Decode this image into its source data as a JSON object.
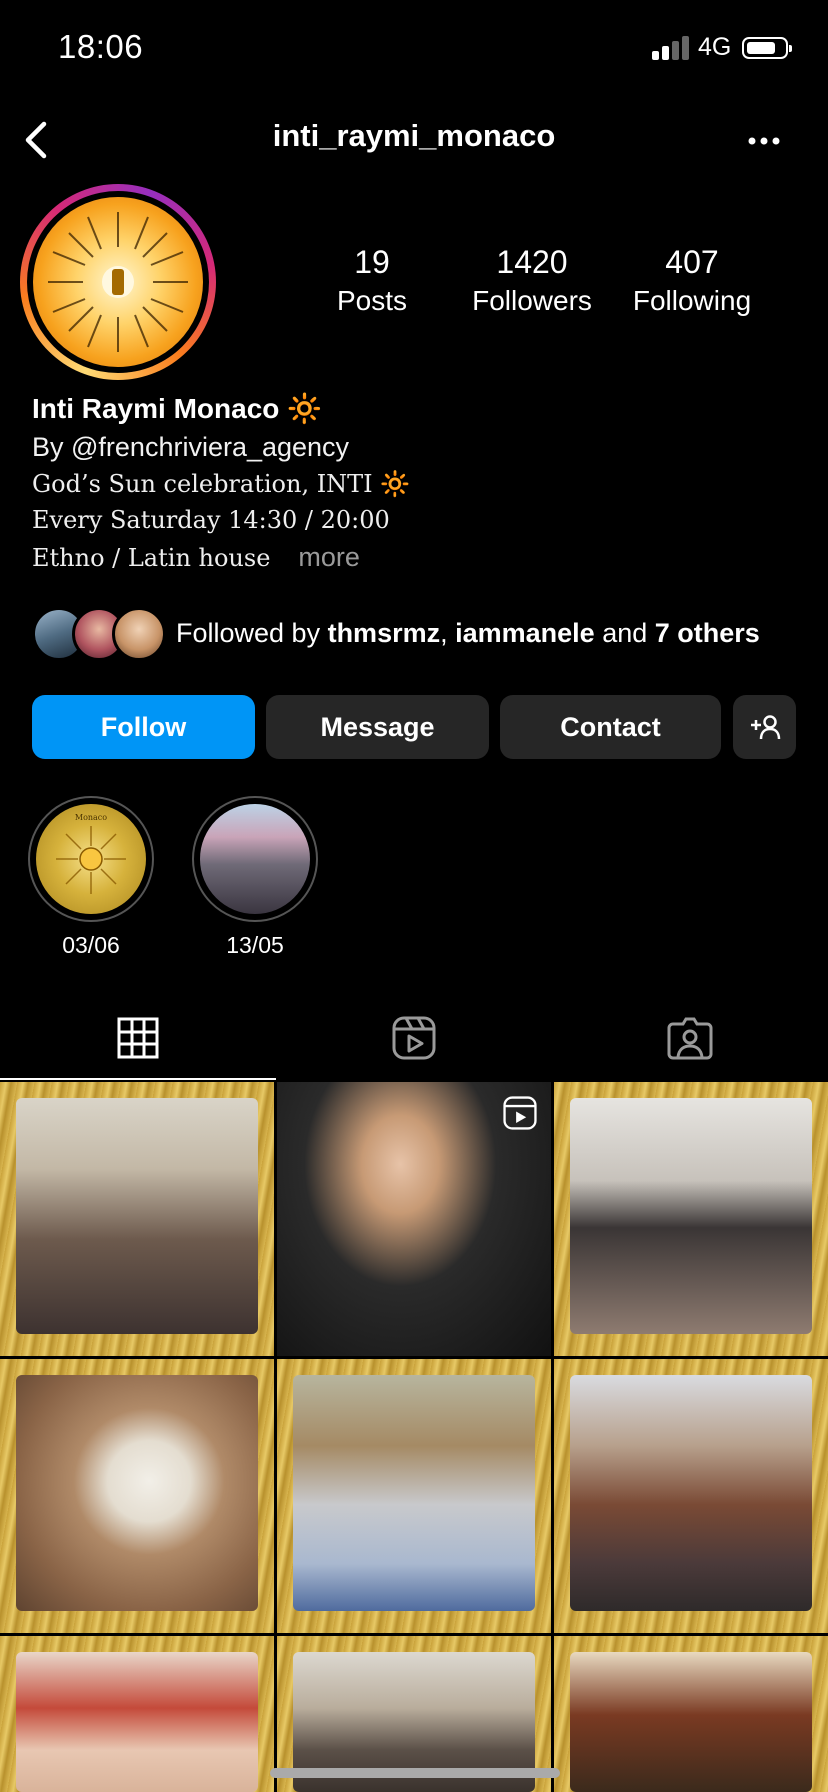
{
  "status_bar": {
    "time": "18:06",
    "network": "4G"
  },
  "header": {
    "username": "inti_raymi_monaco"
  },
  "stats": [
    {
      "value": "19",
      "label": "Posts"
    },
    {
      "value": "1420",
      "label": "Followers"
    },
    {
      "value": "407",
      "label": "Following"
    }
  ],
  "bio": {
    "name": "Inti Raymi Monaco 🔆",
    "by_line": "By @frenchriviera_agency",
    "line1": "God’s Sun celebration, INTI 🔆",
    "line2": "Every Saturday 14:30 / 20:00",
    "line3": "Ethno / Latin house",
    "more": "more"
  },
  "followed_by": {
    "prefix": "Followed by ",
    "user1": "thmsrmz",
    "separator": ", ",
    "user2": "iammanele",
    "and": " and ",
    "others": "7 others"
  },
  "buttons": {
    "follow": "Follow",
    "message": "Message",
    "contact": "Contact"
  },
  "highlights": [
    {
      "label": "03/06",
      "badge": "Monaco"
    },
    {
      "label": "13/05"
    }
  ],
  "tabs": [
    "grid-tab",
    "reels-tab",
    "tagged-tab"
  ],
  "colors": {
    "follow_blue": "#0095f6",
    "button_grey": "#262626",
    "gold": "#d8b54f"
  }
}
